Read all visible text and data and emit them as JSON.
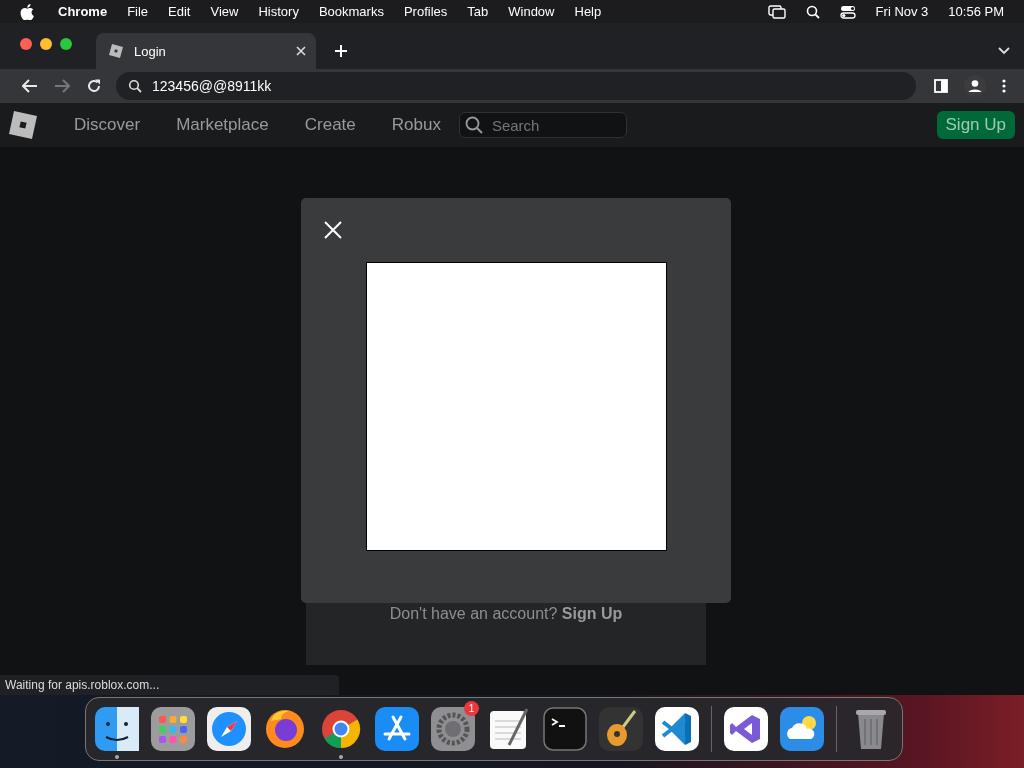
{
  "menu_bar": {
    "app": "Chrome",
    "items": [
      "File",
      "Edit",
      "View",
      "History",
      "Bookmarks",
      "Profiles",
      "Tab",
      "Window",
      "Help"
    ],
    "date": "Fri Nov 3",
    "time": "10:56 PM"
  },
  "tabs": [
    {
      "label": "Login",
      "selected": true
    }
  ],
  "address_bar": {
    "value": "123456@@8911kk"
  },
  "site_nav": {
    "items": [
      "Discover",
      "Marketplace",
      "Create",
      "Robux"
    ],
    "search": {
      "placeholder": "Search"
    },
    "signup_button": "Sign Up"
  },
  "login_card": {
    "prompt": "Don't have an account?",
    "link": "Sign Up"
  },
  "status_bar": "Waiting for apis.roblox.com...",
  "dock": [
    {
      "kind": "finder",
      "running": true
    },
    {
      "kind": "launchpad",
      "running": false
    },
    {
      "kind": "safari",
      "running": false
    },
    {
      "kind": "firefox",
      "running": false
    },
    {
      "kind": "chrome",
      "running": true
    },
    {
      "kind": "appstore",
      "running": false
    },
    {
      "kind": "settings",
      "running": false,
      "badge": "1"
    },
    {
      "kind": "textedit",
      "running": false
    },
    {
      "kind": "terminal",
      "running": false
    },
    {
      "kind": "garageband",
      "running": false
    },
    {
      "kind": "vscode",
      "running": false
    },
    {
      "kind": "separator"
    },
    {
      "kind": "visualstudio",
      "running": false
    },
    {
      "kind": "weather",
      "running": false
    },
    {
      "kind": "separator"
    },
    {
      "kind": "trash",
      "running": false
    }
  ]
}
